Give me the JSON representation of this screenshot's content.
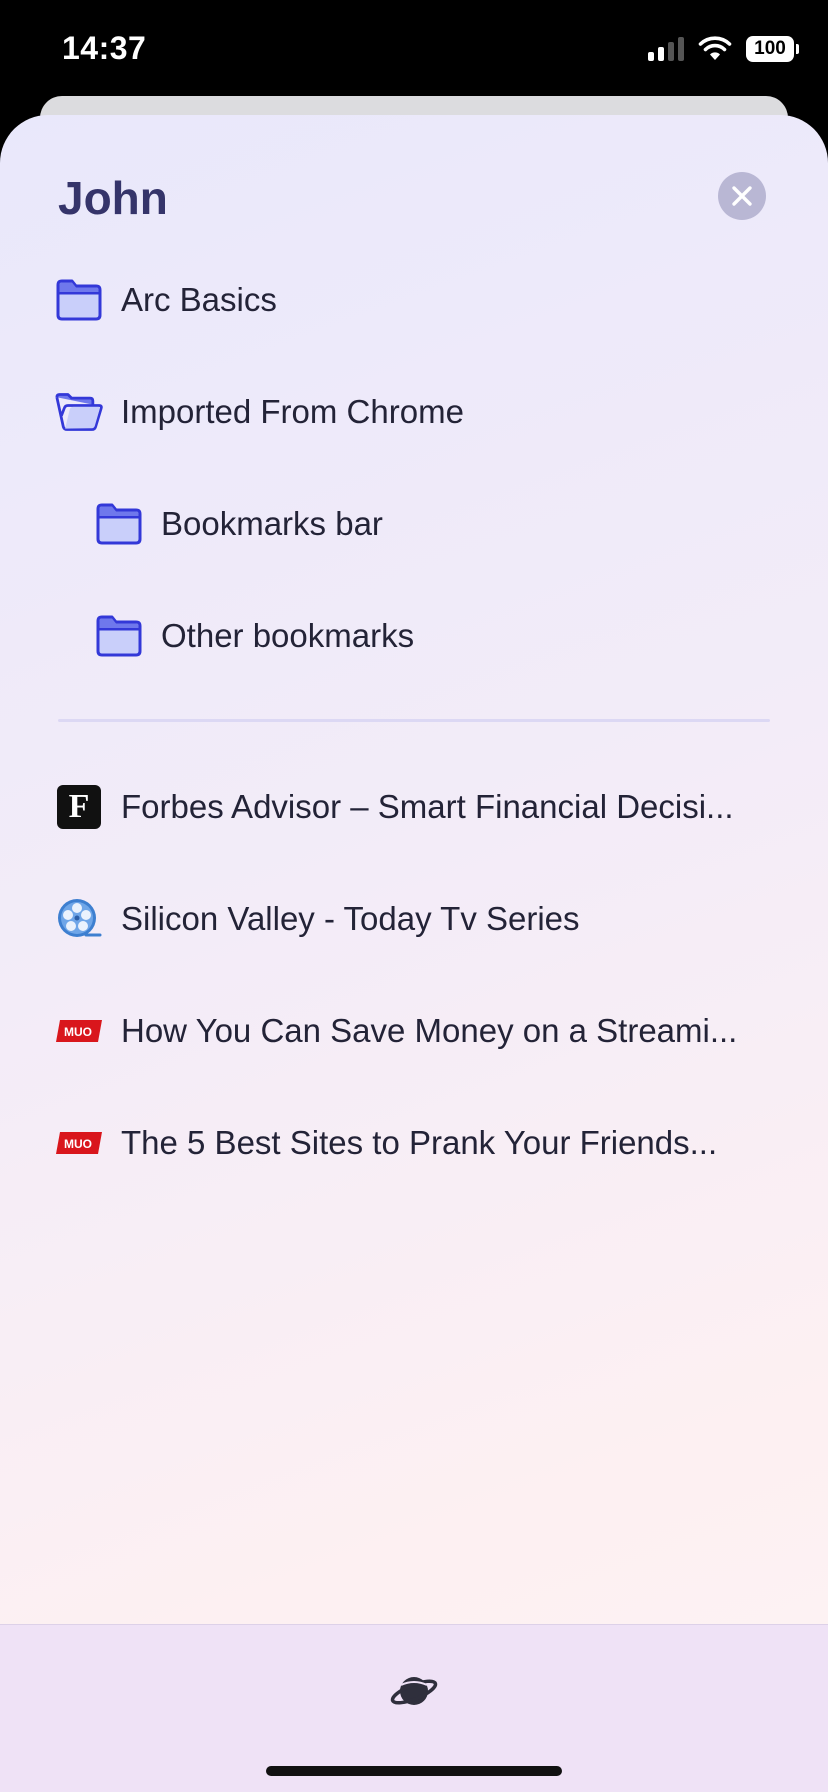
{
  "status": {
    "time": "14:37",
    "battery": "100"
  },
  "sheet": {
    "title": "John",
    "close_icon": "close-icon"
  },
  "folders": [
    {
      "label": "Arc Basics",
      "icon": "folder-icon"
    },
    {
      "label": "Imported From Chrome",
      "icon": "folder-open-icon"
    },
    {
      "label": "Bookmarks bar",
      "icon": "folder-icon"
    },
    {
      "label": "Other bookmarks",
      "icon": "folder-icon"
    }
  ],
  "bookmarks": [
    {
      "label": "Forbes Advisor – Smart Financial Decisi...",
      "icon": "forbes-favicon",
      "icon_text": "F"
    },
    {
      "label": "Silicon Valley - Today Tv Series",
      "icon": "film-reel-favicon"
    },
    {
      "label": "How You Can Save Money on a Streami...",
      "icon": "muo-favicon",
      "icon_text": "MUO"
    },
    {
      "label": "The 5 Best Sites to Prank Your Friends...",
      "icon": "muo-favicon",
      "icon_text": "MUO"
    }
  ],
  "bottom_bar": {
    "icon": "planet-icon"
  },
  "colors": {
    "title": "#35346a",
    "folder_stroke": "#3338d8",
    "folder_fill": "#c9cffa",
    "muo_red": "#d9161c"
  }
}
